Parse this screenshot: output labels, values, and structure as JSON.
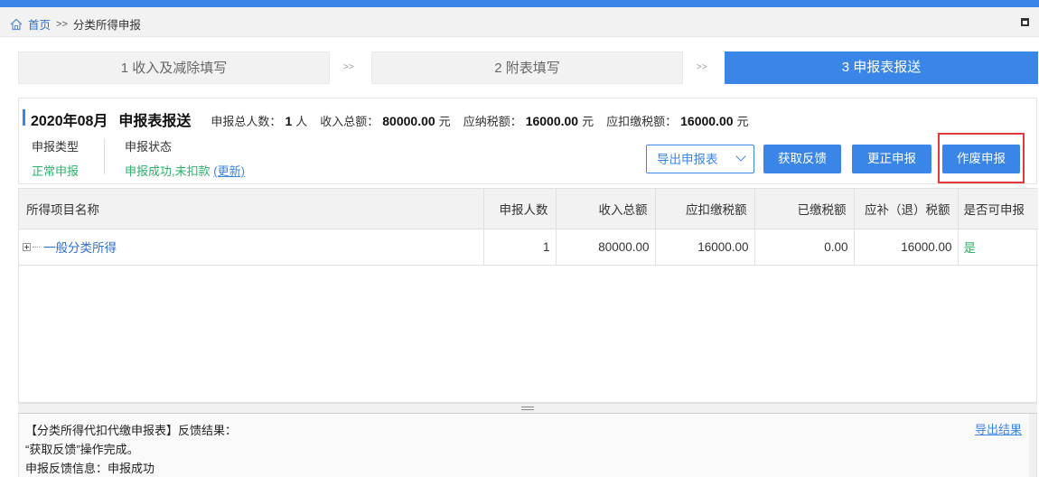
{
  "breadcrumb": {
    "home": "首页",
    "separator": ">>",
    "current": "分类所得申报"
  },
  "steps": [
    {
      "label": "1 收入及减除填写",
      "active": false
    },
    {
      "label": "2 附表填写",
      "active": false
    },
    {
      "label": "3 申报表报送",
      "active": true
    }
  ],
  "step_arrow": ">>",
  "summary": {
    "period": "2020年08月",
    "title": "申报表报送",
    "stats": [
      {
        "label": "申报总人数：",
        "value": "1",
        "unit": "人"
      },
      {
        "label": "收入总额：",
        "value": "80000.00",
        "unit": "元"
      },
      {
        "label": "应纳税额：",
        "value": "16000.00",
        "unit": "元"
      },
      {
        "label": "应扣缴税额：",
        "value": "16000.00",
        "unit": "元"
      }
    ],
    "decl_type_label": "申报类型",
    "decl_type_value": "正常申报",
    "decl_status_label": "申报状态",
    "decl_status_value": "申报成功,未扣款",
    "update_link": "(更新)"
  },
  "actions": {
    "export": "导出申报表",
    "feedback": "获取反馈",
    "correct": "更正申报",
    "void": "作废申报"
  },
  "table": {
    "headers": [
      "所得项目名称",
      "申报人数",
      "收入总额",
      "应扣缴税额",
      "已缴税额",
      "应补（退）税额",
      "是否可申报"
    ],
    "rows": [
      [
        "一般分类所得",
        "1",
        "80000.00",
        "16000.00",
        "0.00",
        "16000.00",
        "是"
      ]
    ]
  },
  "feedback_panel": {
    "line1": "【分类所得代扣代缴申报表】反馈结果：",
    "line2": "“获取反馈”操作完成。",
    "line3": "申报反馈信息：申报成功",
    "export_link": "导出结果"
  },
  "colors": {
    "accent": "#3a85e8",
    "success": "#2bb26a",
    "highlight": "#e03a3a"
  }
}
